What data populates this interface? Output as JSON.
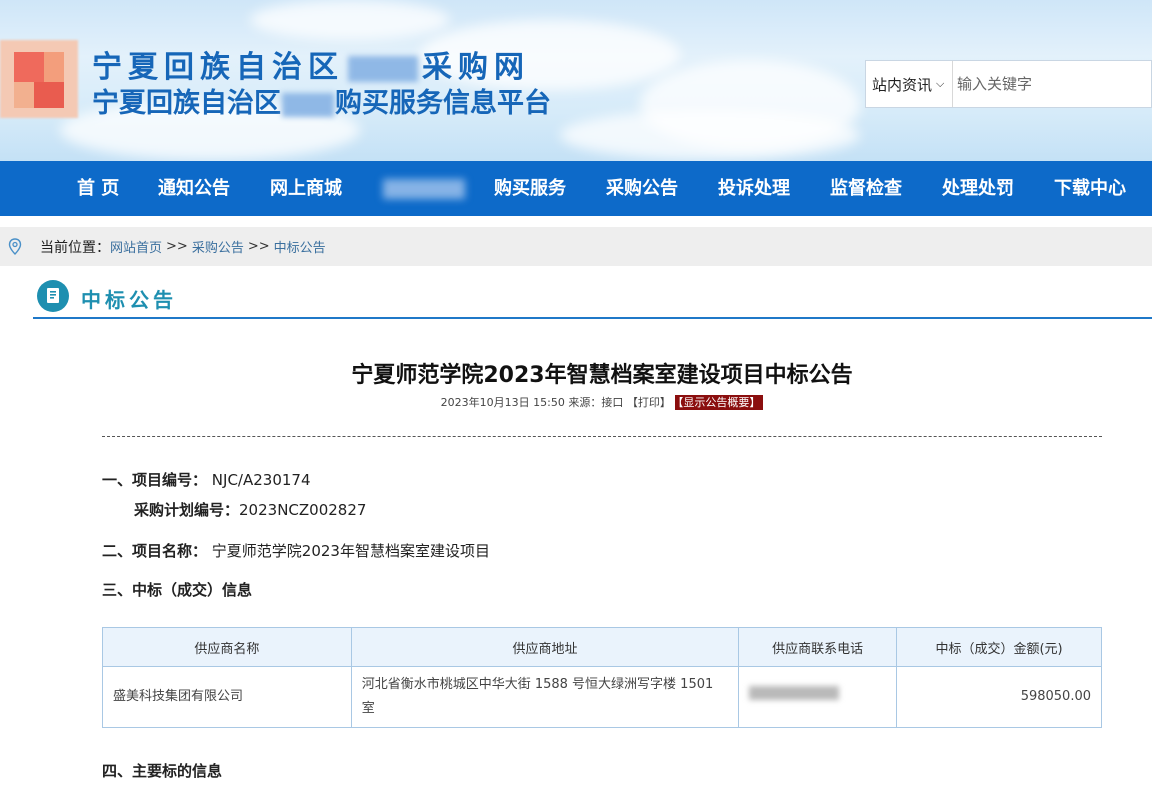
{
  "header": {
    "title_line1_a": "宁夏回族自治区",
    "title_line1_b": "采购网",
    "title_line2_a": "宁夏回族自治区",
    "title_line2_b": "购买服务信息平台"
  },
  "search": {
    "scope": "站内资讯",
    "placeholder": "输入关键字"
  },
  "nav": [
    "首 页",
    "通知公告",
    "网上商城",
    "购买服务",
    "采购公告",
    "投诉处理",
    "监督检查",
    "处理处罚",
    "下载中心"
  ],
  "breadcrumb": {
    "label": "当前位置：",
    "items": [
      "网站首页",
      "采购公告",
      "中标公告"
    ],
    "sep": ">>"
  },
  "section": {
    "title": "中标公告"
  },
  "article": {
    "title": "宁夏师范学院2023年智慧档案室建设项目中标公告",
    "meta": "2023年10月13日 15:50 来源：接口 【打印】",
    "summary_tag": "【显示公告概要】",
    "project_no_label": "一、项目编号：",
    "project_no": "NJC/A230174",
    "plan_no_label": "采购计划编号：",
    "plan_no": "2023NCZ002827",
    "project_name_label": "二、项目名称：",
    "project_name": "宁夏师范学院2023年智慧档案室建设项目",
    "section3": "三、中标（成交）信息",
    "section4": "四、主要标的信息"
  },
  "table": {
    "headers": [
      "供应商名称",
      "供应商地址",
      "供应商联系电话",
      "中标（成交）金额(元)"
    ],
    "row": {
      "name": "盛美科技集团有限公司",
      "address": "河北省衡水市桃城区中华大街 1588 号恒大绿洲写字楼 1501 室",
      "amount": "598050.00"
    }
  }
}
